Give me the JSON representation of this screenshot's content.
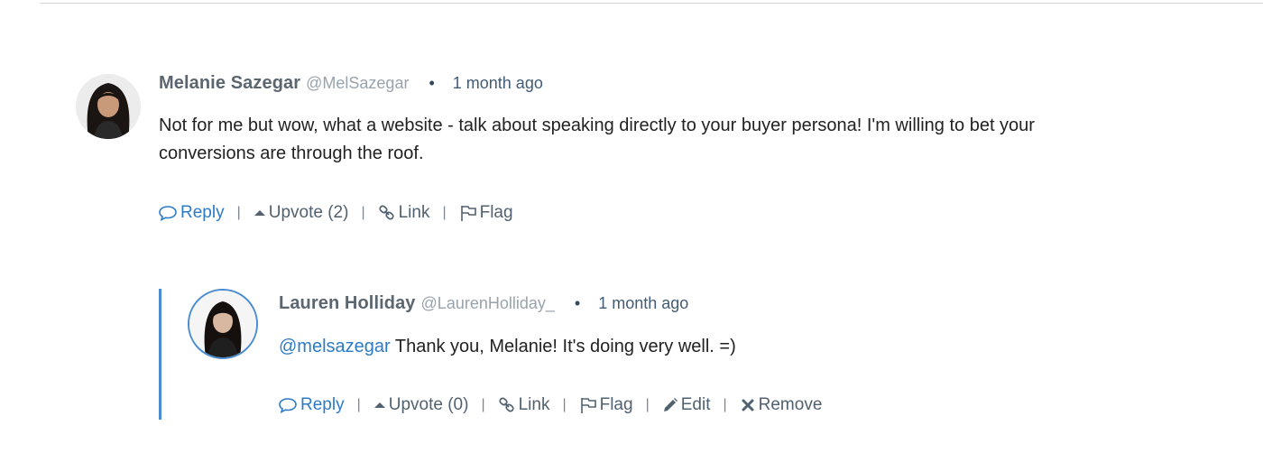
{
  "comments": [
    {
      "author": "Melanie Sazegar",
      "handle": "@MelSazegar",
      "separator": "•",
      "time": "1 month ago",
      "body": "Not for me but wow, what a website - talk about speaking directly to your buyer persona! I'm willing to bet your conversions are through the roof.",
      "actions": {
        "reply": "Reply",
        "upvote": "Upvote (2)",
        "link": "Link",
        "flag": "Flag"
      }
    }
  ],
  "replies": [
    {
      "author": "Lauren Holliday",
      "handle": "@LaurenHolliday_",
      "separator": "•",
      "time": "1 month ago",
      "mention": "@melsazegar",
      "body": " Thank you, Melanie! It's doing very well. =)",
      "actions": {
        "reply": "Reply",
        "upvote": "Upvote (0)",
        "link": "Link",
        "flag": "Flag",
        "edit": "Edit",
        "remove": "Remove"
      }
    }
  ],
  "colors": {
    "accent": "#2d7bc6",
    "thread_rule": "#4a8cd1",
    "author": "#5b6670",
    "handle": "#99a3ad"
  },
  "icons": [
    "speech-bubble-icon",
    "caret-up-icon",
    "chain-link-icon",
    "flag-icon",
    "pencil-icon",
    "x-icon"
  ]
}
